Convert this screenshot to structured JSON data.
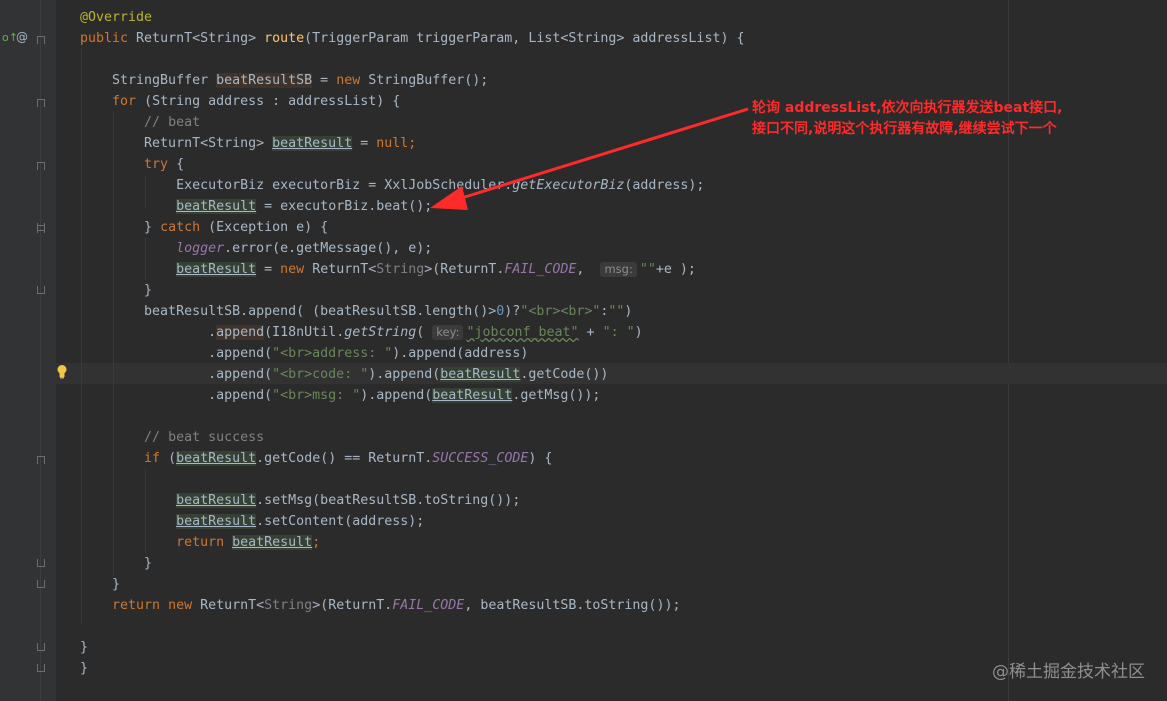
{
  "editor": {
    "lines": [
      {
        "row": 0,
        "t": [
          [
            "an",
            "@Override"
          ]
        ]
      },
      {
        "row": 1,
        "t": [
          [
            "kw",
            "public "
          ],
          [
            "",
            "ReturnT<String> "
          ],
          [
            "fn",
            "route"
          ],
          [
            "",
            "(TriggerParam triggerParam, List<String> addressList) {"
          ]
        ]
      },
      {
        "row": 2,
        "t": []
      },
      {
        "row": 3,
        "t": [
          [
            "",
            "    StringBuffer "
          ],
          [
            "hlw",
            "beatResultSB"
          ],
          [
            "",
            " = "
          ],
          [
            "kw",
            "new "
          ],
          [
            "",
            "StringBuffer();"
          ]
        ]
      },
      {
        "row": 4,
        "t": [
          [
            "",
            "    "
          ],
          [
            "kw",
            "for "
          ],
          [
            "",
            "(String address : addressList) {"
          ]
        ]
      },
      {
        "row": 5,
        "t": [
          [
            "",
            "        "
          ],
          [
            "cm",
            "// beat"
          ]
        ]
      },
      {
        "row": 6,
        "t": [
          [
            "",
            "        ReturnT<String> "
          ],
          [
            "hlv",
            "beatResult"
          ],
          [
            "",
            " = "
          ],
          [
            "kw",
            "null"
          ],
          [
            "kw",
            ";"
          ]
        ]
      },
      {
        "row": 7,
        "t": [
          [
            "",
            "        "
          ],
          [
            "kw",
            "try "
          ],
          [
            "",
            "{"
          ]
        ]
      },
      {
        "row": 8,
        "t": [
          [
            "",
            "            ExecutorBiz executorBiz = XxlJobScheduler."
          ],
          [
            "it",
            "getExecutorBiz"
          ],
          [
            "",
            "(address);"
          ]
        ]
      },
      {
        "row": 9,
        "t": [
          [
            "",
            "            "
          ],
          [
            "hlv",
            "beatResult"
          ],
          [
            "",
            " = executorBiz.beat();"
          ]
        ]
      },
      {
        "row": 10,
        "t": [
          [
            "",
            "        } "
          ],
          [
            "kw",
            "catch "
          ],
          [
            "",
            "(Exception e) {"
          ]
        ]
      },
      {
        "row": 11,
        "t": [
          [
            "",
            "            "
          ],
          [
            "const",
            "logger"
          ],
          [
            "",
            ".error(e.getMessage(), e);"
          ]
        ]
      },
      {
        "row": 12,
        "t": [
          [
            "",
            "            "
          ],
          [
            "hlv",
            "beatResult"
          ],
          [
            "",
            " = "
          ],
          [
            "kw",
            "new "
          ],
          [
            "",
            "ReturnT<"
          ],
          [
            "dim",
            "String"
          ],
          [
            "",
            ">(ReturnT."
          ],
          [
            "const",
            "FAIL_CODE"
          ],
          [
            "",
            ",  "
          ],
          [
            "hint",
            "msg:"
          ],
          [
            "str",
            "\"\""
          ],
          [
            "",
            "+e );"
          ]
        ]
      },
      {
        "row": 13,
        "t": [
          [
            "",
            "        }"
          ]
        ]
      },
      {
        "row": 14,
        "t": [
          [
            "",
            "        beatResultSB.append( (beatResultSB.length()>"
          ],
          [
            "num",
            "0"
          ],
          [
            "",
            ")?"
          ],
          [
            "str",
            "\"<br><br>\""
          ],
          [
            "",
            ":"
          ],
          [
            "str",
            "\"\""
          ],
          [
            "",
            ")"
          ]
        ]
      },
      {
        "row": 15,
        "t": [
          [
            "",
            "                ."
          ],
          [
            "hlw",
            "append"
          ],
          [
            "",
            "(I18nUtil."
          ],
          [
            "it",
            "getString"
          ],
          [
            "",
            "( "
          ],
          [
            "hint",
            "key:"
          ],
          [
            "str",
            "\"jobconf_beat\""
          ],
          [
            "",
            " + "
          ],
          [
            "str",
            "\": \""
          ],
          [
            "",
            ")"
          ]
        ]
      },
      {
        "row": 16,
        "t": [
          [
            "",
            "                .append("
          ],
          [
            "str",
            "\"<br>address: \""
          ],
          [
            "",
            ").append(address)"
          ]
        ]
      },
      {
        "row": 17,
        "t": [
          [
            "",
            "                .append("
          ],
          [
            "str",
            "\"<br>code: \""
          ],
          [
            "",
            ").append("
          ],
          [
            "hlv",
            "beatResult"
          ],
          [
            "",
            ".getCode())"
          ]
        ]
      },
      {
        "row": 18,
        "t": [
          [
            "",
            "                .append("
          ],
          [
            "str",
            "\"<br>msg: \""
          ],
          [
            "",
            ").append("
          ],
          [
            "hlv",
            "beatResult"
          ],
          [
            "",
            ".getMsg());"
          ]
        ]
      },
      {
        "row": 19,
        "t": []
      },
      {
        "row": 20,
        "t": [
          [
            "",
            "        "
          ],
          [
            "cm",
            "// beat success"
          ]
        ]
      },
      {
        "row": 21,
        "t": [
          [
            "",
            "        "
          ],
          [
            "kw",
            "if "
          ],
          [
            "",
            "("
          ],
          [
            "hlv",
            "beatResult"
          ],
          [
            "",
            ".getCode() == ReturnT."
          ],
          [
            "const",
            "SUCCESS_CODE"
          ],
          [
            "",
            ") {"
          ]
        ]
      },
      {
        "row": 22,
        "t": []
      },
      {
        "row": 23,
        "t": [
          [
            "",
            "            "
          ],
          [
            "hlv",
            "beatResult"
          ],
          [
            "",
            ".setMsg(beatResultSB.toString());"
          ]
        ]
      },
      {
        "row": 24,
        "t": [
          [
            "",
            "            "
          ],
          [
            "hlv",
            "beatResult"
          ],
          [
            "",
            ".setContent(address);"
          ]
        ]
      },
      {
        "row": 25,
        "t": [
          [
            "",
            "            "
          ],
          [
            "kw",
            "return "
          ],
          [
            "hlv",
            "beatResult"
          ],
          [
            "kw",
            ";"
          ]
        ]
      },
      {
        "row": 26,
        "t": [
          [
            "",
            "        }"
          ]
        ]
      },
      {
        "row": 27,
        "t": [
          [
            "",
            "    }"
          ]
        ]
      },
      {
        "row": 28,
        "t": [
          [
            "",
            "    "
          ],
          [
            "kw",
            "return new "
          ],
          [
            "",
            "ReturnT<"
          ],
          [
            "dim",
            "String"
          ],
          [
            "",
            ">(ReturnT."
          ],
          [
            "const",
            "FAIL_CODE"
          ],
          [
            "",
            ", beatResultSB.toString());"
          ]
        ]
      },
      {
        "row": 29,
        "t": []
      },
      {
        "row": 30,
        "t": [
          [
            "",
            "}"
          ]
        ]
      },
      {
        "row": 31,
        "t": [
          [
            "",
            "}"
          ]
        ]
      }
    ]
  },
  "annotation": {
    "line1": "轮询 addressList,依次向执行器发送beat接口,",
    "line2": "接口不同,说明这个执行器有故障,继续尝试下一个",
    "color": "#ff2a2a"
  },
  "gutter": {
    "override_icon": "override-arrow-icon",
    "at_icon": "at-sign-icon",
    "bulb_icon": "lightbulb-icon"
  },
  "watermark": "@稀土掘金技术社区"
}
